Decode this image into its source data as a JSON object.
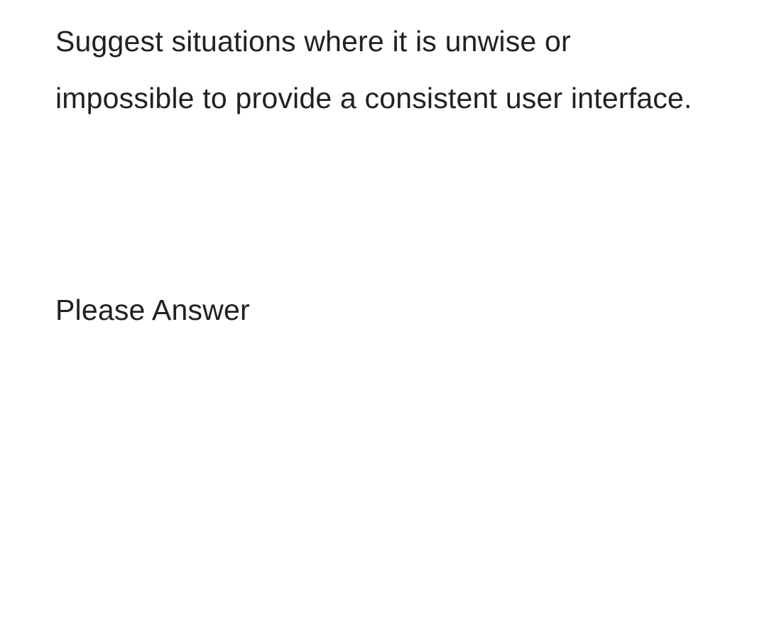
{
  "question": "Suggest situations where it is unwise or impossible to provide a consistent user interface.",
  "prompt": "Please Answer"
}
